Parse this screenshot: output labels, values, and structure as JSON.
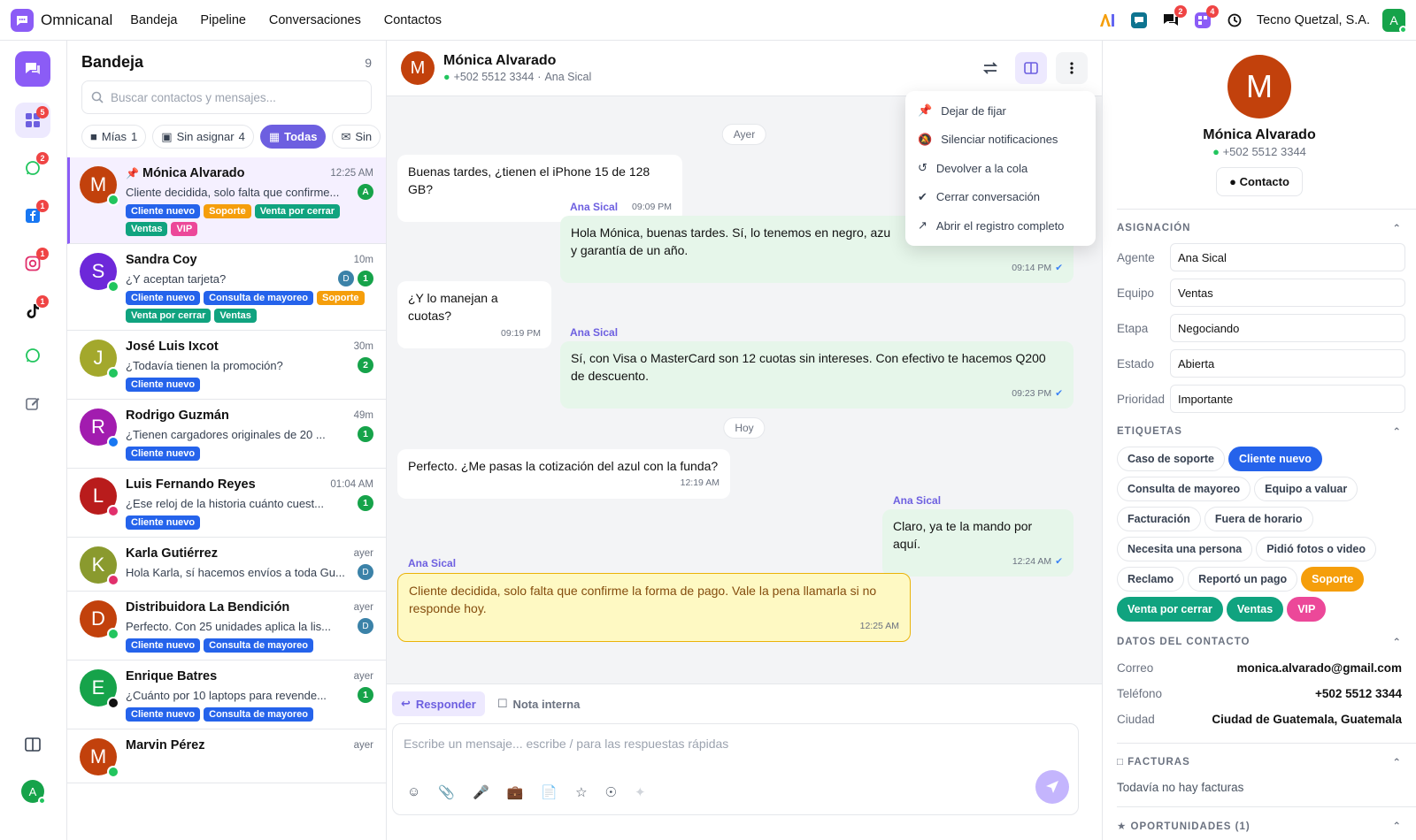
{
  "app": {
    "name": "Omnicanal",
    "company": "Tecno Quetzal, S.A.",
    "user_initial": "A"
  },
  "nav": [
    "Bandeja",
    "Pipeline",
    "Conversaciones",
    "Contactos"
  ],
  "top_badges": {
    "chat": "2",
    "apps": "4"
  },
  "rail_badges": {
    "inbox": "5",
    "whatsapp": "2",
    "facebook": "1",
    "instagram": "1",
    "tiktok": "1"
  },
  "inbox": {
    "title": "Bandeja",
    "count": "9",
    "search_placeholder": "Buscar contactos y mensajes...",
    "chips": [
      {
        "label": "Mías",
        "count": "1"
      },
      {
        "label": "Sin asignar",
        "count": "4"
      },
      {
        "label": "Todas",
        "count": ""
      },
      {
        "label": "Sin",
        "count": ""
      }
    ],
    "rows": [
      {
        "initial": "M",
        "color": "#c2410c",
        "name": "Mónica Alvarado",
        "time": "12:25 AM",
        "preview": "Cliente decidida, solo falta que confirme...",
        "badge": "A",
        "badge_type": "agent",
        "tags": [
          "Cliente nuevo",
          "Soporte",
          "Venta por cerrar",
          "Ventas",
          "VIP"
        ]
      },
      {
        "initial": "S",
        "color": "#6d28d9",
        "name": "Sandra Coy",
        "time": "10m",
        "preview": "¿Y aceptan tarjeta?",
        "badge": "1",
        "mini": "D",
        "tags": [
          "Cliente nuevo",
          "Consulta de mayoreo",
          "Soporte",
          "Venta por cerrar",
          "Ventas"
        ]
      },
      {
        "initial": "J",
        "color": "#a3a82c",
        "name": "José Luis Ixcot",
        "time": "30m",
        "preview": "¿Todavía tienen la promoción?",
        "badge": "2",
        "tags": [
          "Cliente nuevo"
        ]
      },
      {
        "initial": "R",
        "color": "#a21caf",
        "name": "Rodrigo Guzmán",
        "time": "49m",
        "preview": "¿Tienen cargadores originales de 20 ...",
        "badge": "1",
        "tags": [
          "Cliente nuevo"
        ]
      },
      {
        "initial": "L",
        "color": "#b91c1c",
        "name": "Luis Fernando Reyes",
        "time": "01:04 AM",
        "preview": "¿Ese reloj de la historia cuánto cuest...",
        "badge": "1",
        "tags": [
          "Cliente nuevo"
        ]
      },
      {
        "initial": "K",
        "color": "#8a9a2e",
        "name": "Karla Gutiérrez",
        "time": "ayer",
        "preview": "Hola Karla, sí hacemos envíos a toda Gu...",
        "mini": "D",
        "tags": []
      },
      {
        "initial": "D",
        "color": "#c2410c",
        "name": "Distribuidora La Bendición",
        "time": "ayer",
        "preview": "Perfecto. Con 25 unidades aplica la lis...",
        "mini": "D",
        "tags": [
          "Cliente nuevo",
          "Consulta de mayoreo"
        ]
      },
      {
        "initial": "E",
        "color": "#16a34a",
        "name": "Enrique Batres",
        "time": "ayer",
        "preview": "¿Cuánto por 10 laptops para revende...",
        "badge": "1",
        "tags": [
          "Cliente nuevo",
          "Consulta de mayoreo"
        ]
      },
      {
        "initial": "M",
        "color": "#c2410c",
        "name": "Marvin Pérez",
        "time": "ayer",
        "preview": "",
        "tags": []
      }
    ]
  },
  "chat": {
    "contact": "Mónica Alvarado",
    "phone": "+502 5512 3344",
    "agent": "Ana Sical",
    "initial": "M",
    "day_yesterday": "Ayer",
    "day_today": "Hoy",
    "m1": {
      "text": "Buenas tardes, ¿tienen el iPhone 15 de 128 GB?",
      "time": "09:09 PM"
    },
    "m2": {
      "sender": "Ana Sical",
      "text": "Hola Mónica, buenas tardes. Sí, lo tenemos en negro, azu",
      "text2": "y garantía de un año.",
      "time": "09:14 PM"
    },
    "m3": {
      "text": "¿Y lo manejan a cuotas?",
      "time": "09:19 PM"
    },
    "m4": {
      "sender": "Ana Sical",
      "text": "Sí, con Visa o MasterCard son 12 cuotas sin intereses. Con efectivo te hacemos Q200 de descuento.",
      "time": "09:23 PM"
    },
    "m5": {
      "text": "Perfecto. ¿Me pasas la cotización del azul con la funda?",
      "time": "12:19 AM"
    },
    "m6": {
      "sender": "Ana Sical",
      "text": "Claro, ya te la mando por aquí.",
      "time": "12:24 AM"
    },
    "m7": {
      "sender": "Ana Sical",
      "text": "Cliente decidida, solo falta que confirme la forma de pago. Vale la pena llamarla si no responde hoy.",
      "time": "12:25 AM"
    },
    "reply_tab": "Responder",
    "note_tab": "Nota interna",
    "composer_placeholder": "Escribe un mensaje... escribe / para las respuestas rápidas"
  },
  "menu": [
    "Dejar de fijar",
    "Silenciar notificaciones",
    "Devolver a la cola",
    "Cerrar conversación",
    "Abrir el registro completo"
  ],
  "side": {
    "name": "Mónica Alvarado",
    "phone": "+502 5512 3344",
    "contact_btn": "Contacto",
    "assign_title": "ASIGNACIÓN",
    "fields": [
      {
        "k": "Agente",
        "v": "Ana Sical"
      },
      {
        "k": "Equipo",
        "v": "Ventas"
      },
      {
        "k": "Etapa",
        "v": "Negociando"
      },
      {
        "k": "Estado",
        "v": "Abierta"
      },
      {
        "k": "Prioridad",
        "v": "Importante"
      }
    ],
    "tags_title": "ETIQUETAS",
    "tags": [
      {
        "l": "Caso de soporte",
        "c": ""
      },
      {
        "l": "Cliente nuevo",
        "c": "blue"
      },
      {
        "l": "Consulta de mayoreo",
        "c": ""
      },
      {
        "l": "Equipo a valuar",
        "c": ""
      },
      {
        "l": "Facturación",
        "c": ""
      },
      {
        "l": "Fuera de horario",
        "c": ""
      },
      {
        "l": "Necesita una persona",
        "c": ""
      },
      {
        "l": "Pidió fotos o video",
        "c": ""
      },
      {
        "l": "Reclamo",
        "c": ""
      },
      {
        "l": "Reportó un pago",
        "c": ""
      },
      {
        "l": "Soporte",
        "c": "orange"
      },
      {
        "l": "Venta por cerrar",
        "c": "green"
      },
      {
        "l": "Ventas",
        "c": "green"
      },
      {
        "l": "VIP",
        "c": "pink"
      }
    ],
    "contact_title": "DATOS DEL CONTACTO",
    "contact": [
      {
        "k": "Correo",
        "v": "monica.alvarado@gmail.com"
      },
      {
        "k": "Teléfono",
        "v": "+502 5512 3344"
      },
      {
        "k": "Ciudad",
        "v": "Ciudad de Guatemala, Guatemala"
      }
    ],
    "invoices_title": "FACTURAS",
    "invoices_empty": "Todavía no hay facturas",
    "opps_title": "OPORTUNIDADES (1)"
  },
  "colors": {
    "accent": "#8b5cf6",
    "whatsapp": "#22c55e",
    "facebook": "#1877f2",
    "instagram": "#e1306c"
  }
}
